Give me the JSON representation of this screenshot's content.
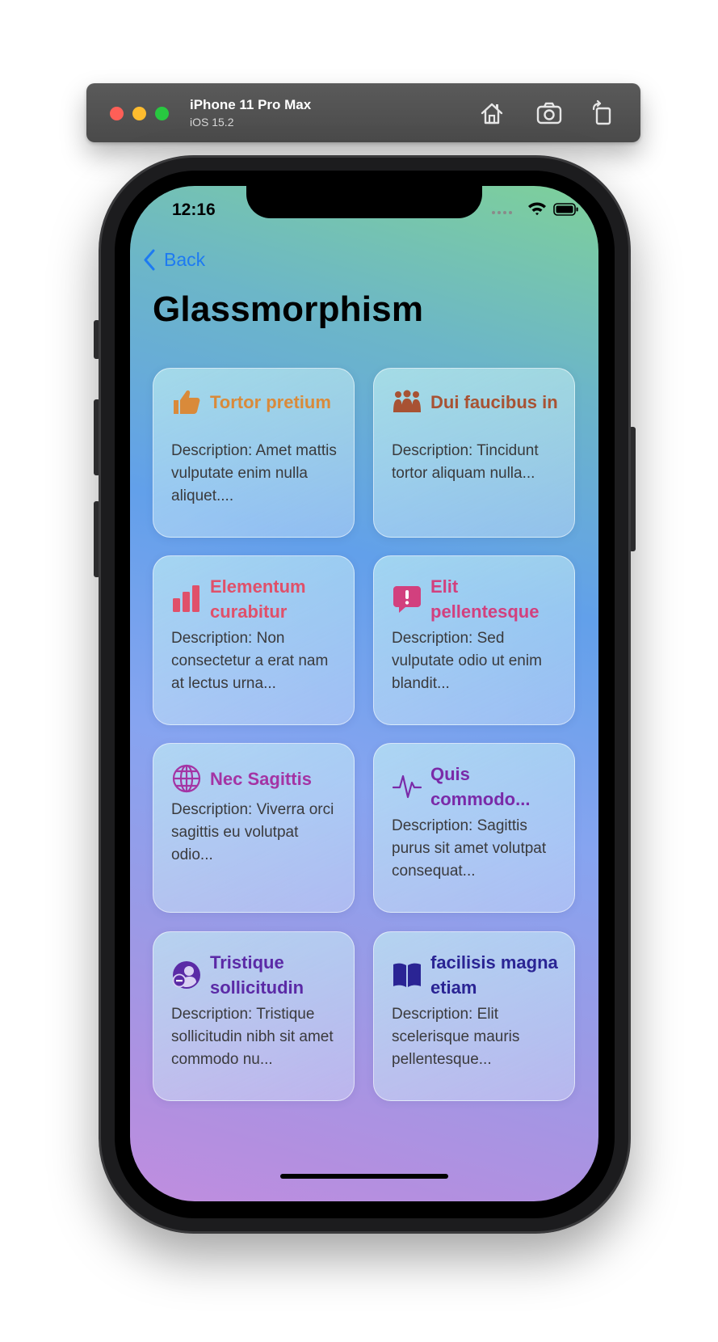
{
  "simulator": {
    "device_name": "iPhone 11 Pro Max",
    "os_version": "iOS 15.2",
    "buttons": [
      "home-icon",
      "screenshot-icon",
      "rotate-icon"
    ]
  },
  "status_bar": {
    "time": "12:16"
  },
  "nav": {
    "back_label": "Back"
  },
  "page": {
    "title": "Glassmorphism"
  },
  "cards": [
    {
      "title": "Tortor pretium",
      "description": "Description: Amet mattis vulputate enim nulla aliquet....",
      "icon": "thumbs-up-icon",
      "color": "#d98a3a"
    },
    {
      "title": "Dui faucibus in",
      "description": "Description: Tincidunt tortor aliquam nulla...",
      "icon": "people-icon",
      "color": "#a85233"
    },
    {
      "title": "Elementum curabitur",
      "description": "Description: Non consectetur a erat nam at lectus urna...",
      "icon": "bar-chart-icon",
      "color": "#e0506a"
    },
    {
      "title": "Elit pellentesque",
      "description": "Description: Sed vulputate odio ut enim blandit...",
      "icon": "exclamation-bubble-icon",
      "color": "#d2407e"
    },
    {
      "title": "Nec Sagittis",
      "description": "Description: Viverra orci sagittis eu volutpat odio...",
      "icon": "globe-icon",
      "color": "#a434a4"
    },
    {
      "title": "Quis commodo...",
      "description": "Description: Sagittis purus sit amet volutpat consequat...",
      "icon": "waveform-icon",
      "color": "#7a2aa8"
    },
    {
      "title": "Tristique sollicitudin",
      "description": "Description: Tristique sollicitudin nibh sit amet commodo nu...",
      "icon": "person-minus-icon",
      "color": "#5b2aa6"
    },
    {
      "title": "facilisis magna etiam",
      "description": "Description: Elit scelerisque mauris pellentesque...",
      "icon": "book-icon",
      "color": "#2a2494"
    }
  ]
}
